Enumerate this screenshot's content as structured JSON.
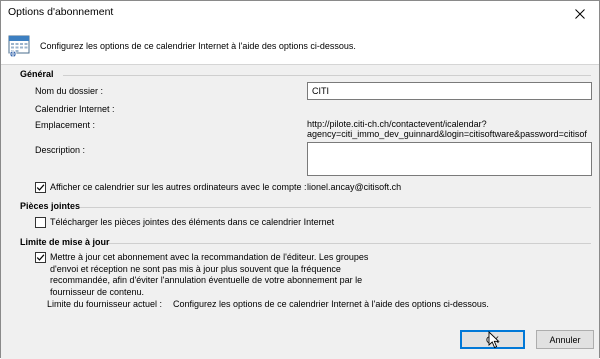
{
  "window": {
    "title": "Options d'abonnement"
  },
  "header": {
    "text": "Configurez les options de ce calendrier Internet à l'aide des options ci-dessous."
  },
  "general": {
    "section_title": "Général",
    "folder_label": "Nom du dossier :",
    "folder_value": "CITI",
    "calendar_label": "Calendrier Internet :",
    "location_label": "Emplacement :",
    "location_line1": "http://pilote.citi-ch.ch/contactevent/icalendar?",
    "location_line2": "agency=citi_immo_dev_guinnard&login=citisoftware&password=citisof",
    "description_label": "Description :",
    "description_value": "",
    "share_checkbox_label": "Afficher ce calendrier sur les autres ordinateurs avec le compte :",
    "share_checked": true,
    "account": "lionel.ancay@citisoft.ch"
  },
  "attachments": {
    "section_title": "Pièces jointes",
    "download_label": "Télécharger les pièces jointes des éléments dans ce calendrier Internet",
    "download_checked": false
  },
  "update_limit": {
    "section_title": "Limite de mise à jour",
    "recommendation_lines": [
      "Mettre à jour cet abonnement avec la recommandation de l'éditeur. Les groupes",
      "d'envoi et réception ne sont pas mis à jour plus souvent que la fréquence",
      "recommandée, afin d'éviter l'annulation éventuelle de votre abonnement par le",
      "fournisseur de contenu."
    ],
    "recommendation_checked": true,
    "provider_limit_label": "Limite du fournisseur actuel :",
    "provider_limit_value": "Configurez les options de ce calendrier Internet à l'aide des options ci-dessous."
  },
  "buttons": {
    "ok": "OK",
    "cancel": "Annuler"
  },
  "colors": {
    "accent": "#0078d7",
    "panel": "#f0f0f0"
  },
  "icons": {
    "close": "close-icon",
    "calendar": "calendar-icon",
    "check": "checkmark-icon",
    "pointer": "mouse-pointer-icon"
  }
}
